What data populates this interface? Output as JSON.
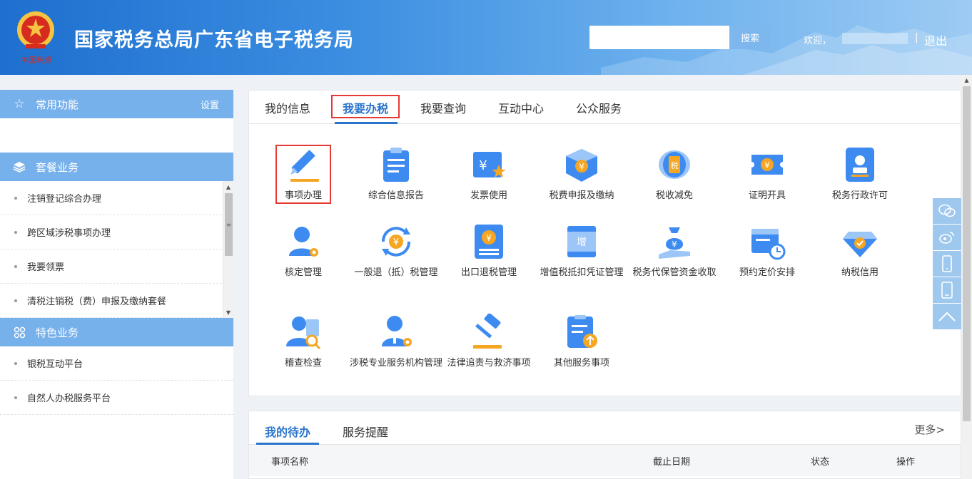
{
  "header": {
    "site_title": "国家税务总局广东省电子税务局",
    "emblem_text": "中国税务",
    "search_placeholder": "",
    "search_button": "搜索",
    "welcome": "欢迎，",
    "separator": "|",
    "logout": "退出"
  },
  "sidebar": {
    "common": {
      "title": "常用功能",
      "setting": "设置",
      "icon": "star-icon"
    },
    "package": {
      "title": "套餐业务",
      "icon": "layers-icon",
      "items": [
        {
          "label": "注销登记综合办理"
        },
        {
          "label": "跨区域涉税事项办理"
        },
        {
          "label": "我要领票"
        },
        {
          "label": "清税注销税（费）申报及缴纳套餐"
        }
      ]
    },
    "special": {
      "title": "特色业务",
      "icon": "grid-icon",
      "items": [
        {
          "label": "银税互动平台"
        },
        {
          "label": "自然人办税服务平台"
        }
      ]
    }
  },
  "tabs": [
    {
      "label": "我的信息"
    },
    {
      "label": "我要办税",
      "active": true
    },
    {
      "label": "我要查询"
    },
    {
      "label": "互动中心"
    },
    {
      "label": "公众服务"
    }
  ],
  "services": [
    {
      "label": "事项办理",
      "icon": "pencil-icon"
    },
    {
      "label": "综合信息报告",
      "icon": "clipboard-icon"
    },
    {
      "label": "发票使用",
      "icon": "invoice-icon"
    },
    {
      "label": "税费申报及缴纳",
      "icon": "tax-box-icon"
    },
    {
      "label": "税收减免",
      "icon": "tax-coin-icon"
    },
    {
      "label": "证明开具",
      "icon": "ticket-icon"
    },
    {
      "label": "税务行政许可",
      "icon": "stamp-icon"
    },
    {
      "label": "核定管理",
      "icon": "user-gear-icon"
    },
    {
      "label": "一般退（抵）税管理",
      "icon": "refund-icon"
    },
    {
      "label": "出口退税管理",
      "icon": "export-book-icon"
    },
    {
      "label": "增值税抵扣凭证管理",
      "icon": "vat-ticket-icon"
    },
    {
      "label": "税务代保管资金收取",
      "icon": "money-bag-icon"
    },
    {
      "label": "预约定价安排",
      "icon": "calendar-clock-icon"
    },
    {
      "label": "纳税信用",
      "icon": "credit-diamond-icon"
    },
    {
      "label": "稽查检查",
      "icon": "inspect-icon"
    },
    {
      "label": "涉税专业服务机构管理",
      "icon": "agent-gear-icon"
    },
    {
      "label": "法律追责与救济事项",
      "icon": "gavel-icon"
    },
    {
      "label": "其他服务事项",
      "icon": "other-doc-icon"
    }
  ],
  "todo": {
    "tabs": [
      {
        "label": "我的待办",
        "active": true
      },
      {
        "label": "服务提醒"
      }
    ],
    "more": "更多>",
    "columns": [
      "事项名称",
      "截止日期",
      "状态",
      "操作"
    ]
  },
  "float_bar": [
    "wechat-icon",
    "weibo-icon",
    "mobile-icon",
    "tablet-icon",
    "back-to-top-icon"
  ],
  "colors": {
    "header_start": "#1e6fcf",
    "accent": "#2a74cc",
    "sidebar_head": "#77b1ec",
    "highlight": "#e53935",
    "icon_blue": "#3d8bf0",
    "icon_orange": "#f5a623"
  }
}
